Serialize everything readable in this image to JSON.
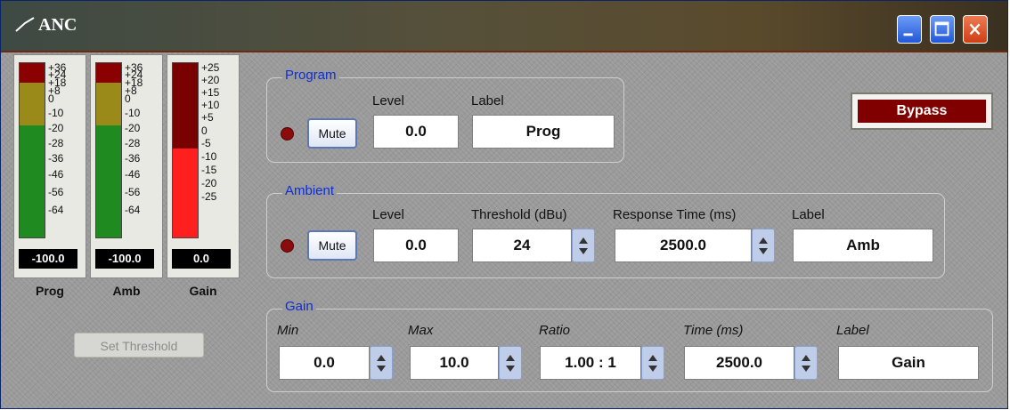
{
  "window": {
    "title": "ANC",
    "colors": {
      "group_title": "#0d2dd8",
      "led": "#8a0c0c",
      "bypass_bg": "#800000"
    }
  },
  "meters": [
    {
      "name": "Prog",
      "readout": "-100.0",
      "ticks": [
        "+36",
        "+24",
        "+18",
        "+8",
        "0",
        "-10",
        "-20",
        "-28",
        "-36",
        "-46",
        "-56",
        "-64"
      ],
      "colors": [
        "#8b0000",
        "#9a8a1a",
        "#1f8a1f"
      ]
    },
    {
      "name": "Amb",
      "readout": "-100.0",
      "ticks": [
        "+36",
        "+24",
        "+18",
        "+8",
        "0",
        "-10",
        "-20",
        "-28",
        "-36",
        "-46",
        "-56",
        "-64"
      ],
      "colors": [
        "#8b0000",
        "#9a8a1a",
        "#1f8a1f"
      ]
    },
    {
      "name": "Gain",
      "readout": "0.0",
      "ticks": [
        "+25",
        "+20",
        "+15",
        "+10",
        "+5",
        "0",
        "-5",
        "-10",
        "-15",
        "-20",
        "-25"
      ],
      "colors": [
        "#7a0000",
        "#ff1f1f"
      ]
    }
  ],
  "set_threshold_label": "Set Threshold",
  "bypass_label": "Bypass",
  "program": {
    "title": "Program",
    "mute_label": "Mute",
    "level_label": "Level",
    "level_value": "0.0",
    "label_label": "Label",
    "label_value": "Prog"
  },
  "ambient": {
    "title": "Ambient",
    "mute_label": "Mute",
    "level_label": "Level",
    "level_value": "0.0",
    "threshold_label": "Threshold (dBu)",
    "threshold_value": "24",
    "response_label": "Response Time (ms)",
    "response_value": "2500.0",
    "label_label": "Label",
    "label_value": "Amb"
  },
  "gain": {
    "title": "Gain",
    "min_label": "Min",
    "min_value": "0.0",
    "max_label": "Max",
    "max_value": "10.0",
    "ratio_label": "Ratio",
    "ratio_value": "1.00 : 1",
    "time_label": "Time (ms)",
    "time_value": "2500.0",
    "label_label": "Label",
    "label_value": "Gain"
  },
  "icons": {
    "minimize": "minimize-icon",
    "maximize": "maximize-icon",
    "close": "close-icon",
    "logo": "anc-logo-icon"
  }
}
